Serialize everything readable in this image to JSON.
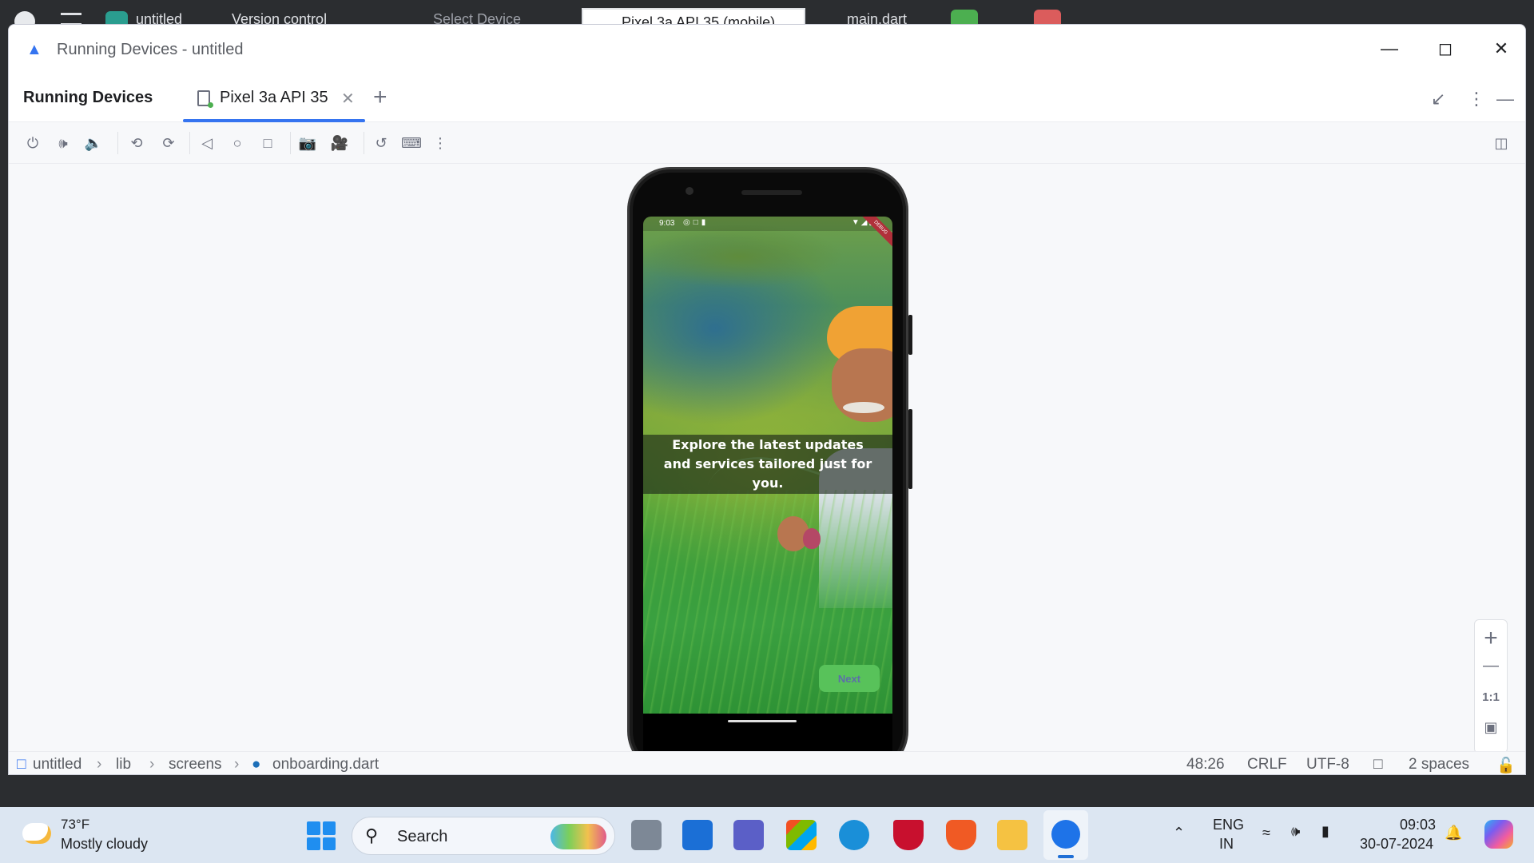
{
  "ide": {
    "project_menu": "untitled",
    "vcs_menu": "Version control",
    "select_device": "Select Device",
    "device_selector": "Pixel 3a API 35 (mobile)",
    "run_config": "main.dart"
  },
  "window": {
    "title": "Running Devices - untitled",
    "panel_title": "Running Devices",
    "tab_label": "Pixel 3a API 35"
  },
  "toolbar": {
    "icons": [
      "power-icon",
      "volume-up-icon",
      "volume-down-icon",
      "rotate-left-icon",
      "rotate-right-icon",
      "back-icon",
      "home-icon",
      "overview-icon",
      "screenshot-icon",
      "screen-record-icon",
      "reset-icon",
      "keyboard-icon",
      "more-icon"
    ]
  },
  "device": {
    "status_time": "9:03",
    "banner_text": "Explore the latest updates and services tailored just for you.",
    "next_button": "Next",
    "debug_label": "DEBUG"
  },
  "zoom": {
    "in": "+",
    "out": "—",
    "actual": "1:1"
  },
  "statusbar": {
    "breadcrumb": [
      "untitled",
      "lib",
      "screens",
      "onboarding.dart"
    ],
    "position": "48:26",
    "line_ending": "CRLF",
    "encoding": "UTF-8",
    "indent": "2 spaces"
  },
  "taskbar": {
    "temperature": "73°F",
    "weather": "Mostly cloudy",
    "search_label": "Search",
    "lang_line1": "ENG",
    "lang_line2": "IN",
    "time": "09:03",
    "date": "30-07-2024"
  },
  "colors": {
    "accent": "#3574f0",
    "next_button_bg": "#58c25a",
    "next_button_text": "#5c6fa8"
  }
}
